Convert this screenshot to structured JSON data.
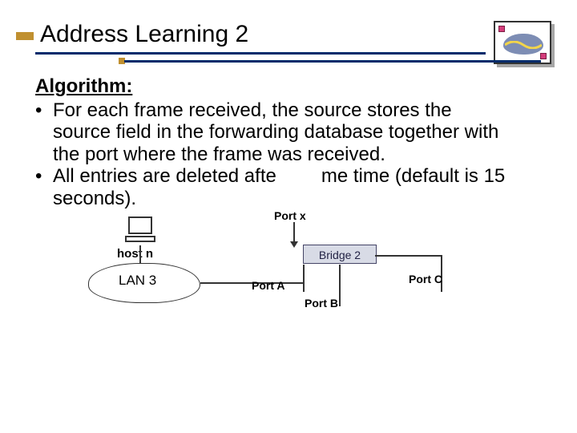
{
  "title": "Address Learning 2",
  "content": {
    "heading": "Algorithm:",
    "bullet1": "For each frame received,  the source stores the source field in the forwarding database  together with the port where the frame was received.",
    "bullet2_pre": "All entries are deleted afte",
    "bullet2_post": "me time (default is 15 seconds)."
  },
  "diagram": {
    "host": "host n",
    "lan": "LAN 3",
    "bridge": "Bridge 2",
    "portx": "Port x",
    "porta": "Port A",
    "portb": "Port B",
    "portc": "Port C"
  }
}
